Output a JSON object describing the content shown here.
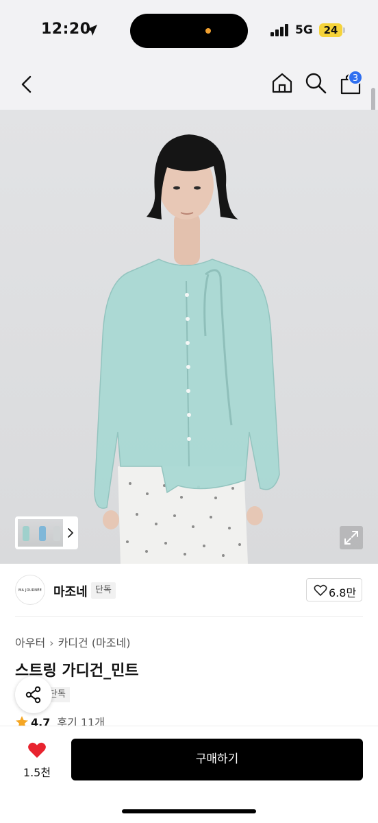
{
  "status_bar": {
    "time": "12:20",
    "network": "5G",
    "battery": "24",
    "location_icon": "location-arrow-icon",
    "signal_icon": "signal-bars-icon"
  },
  "nav": {
    "back_icon": "chevron-left-icon",
    "home_icon": "home-icon",
    "search_icon": "search-icon",
    "cart_icon": "shopping-bag-icon",
    "cart_badge": "3"
  },
  "gallery": {
    "thumbnails": 3,
    "expand_icon": "expand-icon",
    "next_icon": "chevron-right-icon"
  },
  "brand": {
    "logo_text": "MA JOURNÉE",
    "name": "마조네",
    "tag": "단독",
    "like_count": "6.8만"
  },
  "product": {
    "breadcrumb": [
      "아우터",
      "카디건 (마조네)"
    ],
    "title": "스트링 가디건_민트",
    "exclusive_tag": "단독",
    "rating": "4.7",
    "review_count": "후기 11개"
  },
  "bottom": {
    "wish_count": "1.5천",
    "buy_label": "구매하기"
  },
  "colors": {
    "accent_blue": "#2f6ff0",
    "heart_red": "#e8232e",
    "star_orange": "#f5a623",
    "cardigan_mint": "#a9d8d3",
    "battery_yellow": "#f5d33a"
  }
}
